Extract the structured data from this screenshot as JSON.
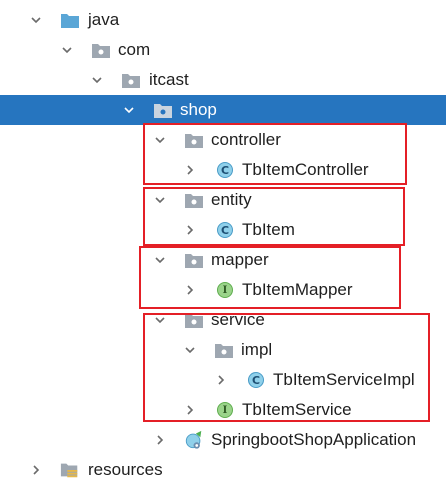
{
  "tree": {
    "java": "java",
    "com": "com",
    "itcast": "itcast",
    "shop": "shop",
    "controller": "controller",
    "TbItemController": "TbItemController",
    "entity": "entity",
    "TbItem": "TbItem",
    "mapper": "mapper",
    "TbItemMapper": "TbItemMapper",
    "service": "service",
    "impl": "impl",
    "TbItemServiceImpl": "TbItemServiceImpl",
    "TbItemService": "TbItemService",
    "SpringbootShopApplication": "SpringbootShopApplication",
    "resources": "resources"
  },
  "icon_glyphs": {
    "class": "C",
    "interface": "I"
  },
  "colors": {
    "selection": "#2675bf",
    "highlight_box": "#e41f26",
    "folder": "#9ea7b1",
    "source_folder": "#5aa6d6",
    "class_icon": "#8fd0ea",
    "interface_icon": "#9ad38a"
  }
}
